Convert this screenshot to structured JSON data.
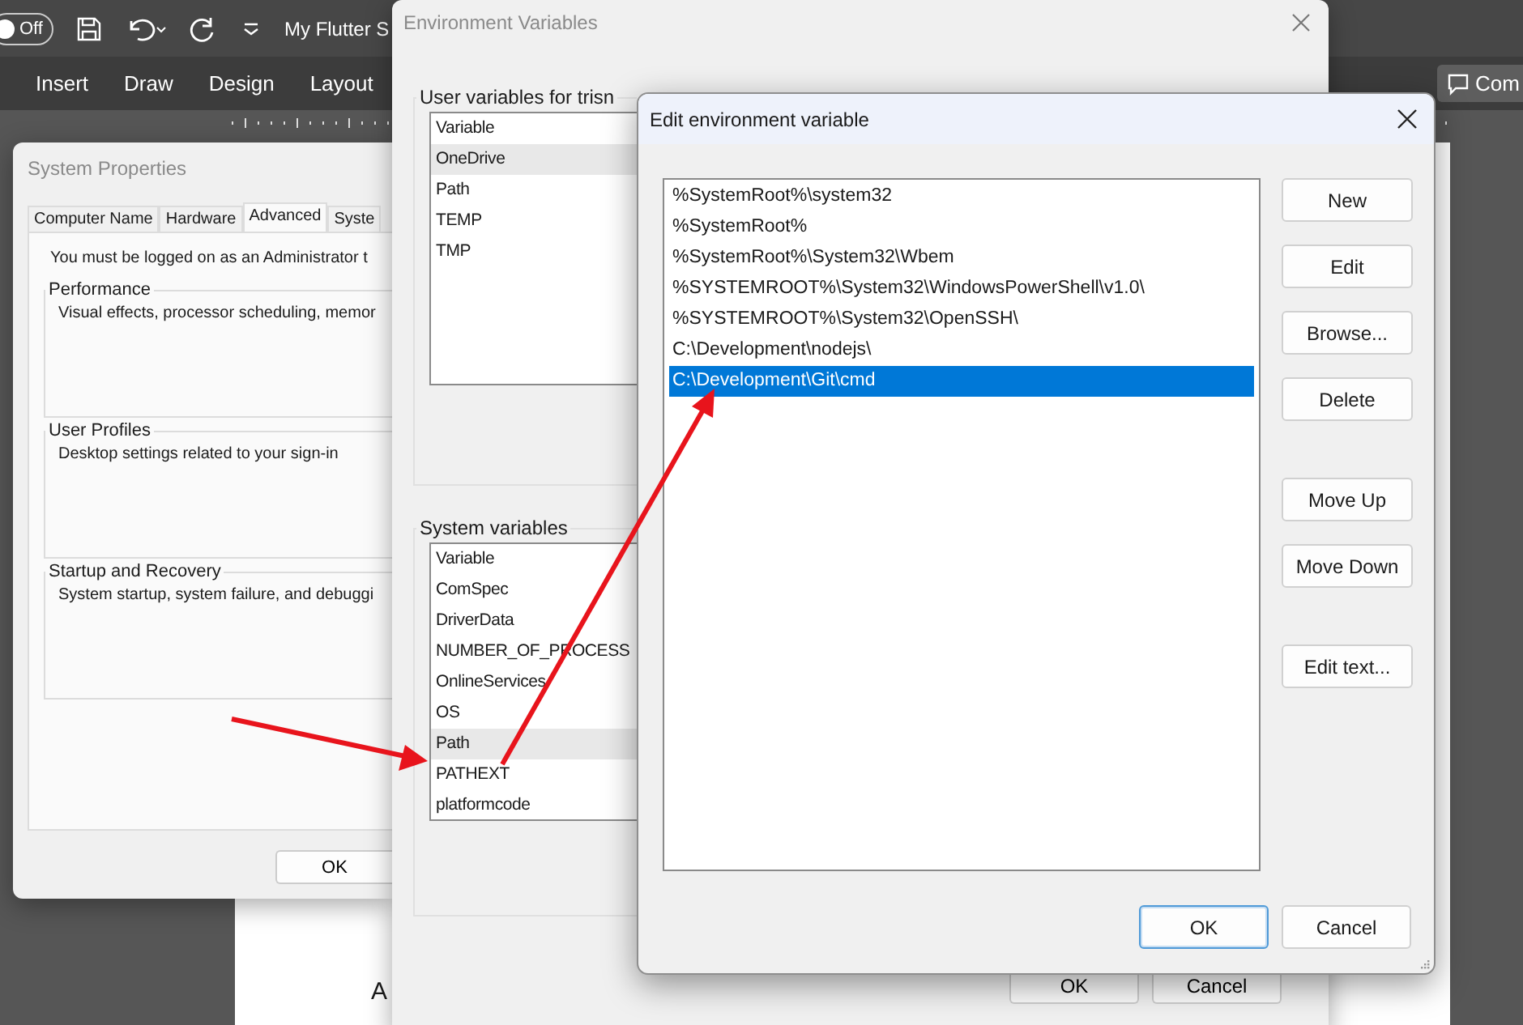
{
  "word": {
    "autosave": {
      "label": "Off",
      "on": false
    },
    "title": "My Flutter S",
    "ribbon_tabs": [
      "Insert",
      "Draw",
      "Design",
      "Layout"
    ],
    "comments_button": "Com",
    "page_text": "A"
  },
  "system_properties": {
    "title": "System Properties",
    "tabs": [
      {
        "label": "Computer Name",
        "selected": false
      },
      {
        "label": "Hardware",
        "selected": false
      },
      {
        "label": "Advanced",
        "selected": true
      },
      {
        "label": "Syste",
        "selected": false
      }
    ],
    "notice": "You must be logged on as an Administrator t",
    "groups": [
      {
        "title": "Performance",
        "description": "Visual effects, processor scheduling, memor"
      },
      {
        "title": "User Profiles",
        "description": "Desktop settings related to your sign-in"
      },
      {
        "title": "Startup and Recovery",
        "description": "System startup, system failure, and debuggi"
      }
    ],
    "ok_button": "OK"
  },
  "environment_variables": {
    "title": "Environment Variables",
    "user_variables": {
      "label": "User variables for trisn",
      "header": "Variable",
      "rows": [
        {
          "name": "OneDrive",
          "selected": true
        },
        {
          "name": "Path",
          "selected": false
        },
        {
          "name": "TEMP",
          "selected": false
        },
        {
          "name": "TMP",
          "selected": false
        }
      ]
    },
    "system_variables": {
      "label": "System variables",
      "header": "Variable",
      "rows": [
        {
          "name": "ComSpec",
          "selected": false
        },
        {
          "name": "DriverData",
          "selected": false
        },
        {
          "name": "NUMBER_OF_PROCESS",
          "selected": false
        },
        {
          "name": "OnlineServices",
          "selected": false
        },
        {
          "name": "OS",
          "selected": false
        },
        {
          "name": "Path",
          "selected": true
        },
        {
          "name": "PATHEXT",
          "selected": false
        },
        {
          "name": "platformcode",
          "selected": false
        }
      ]
    },
    "buttons": [
      "OK",
      "Cancel"
    ]
  },
  "edit_dialog": {
    "title": "Edit environment variable",
    "entries": [
      {
        "text": "%SystemRoot%\\system32",
        "selected": false
      },
      {
        "text": "%SystemRoot%",
        "selected": false
      },
      {
        "text": "%SystemRoot%\\System32\\Wbem",
        "selected": false
      },
      {
        "text": "%SYSTEMROOT%\\System32\\WindowsPowerShell\\v1.0\\",
        "selected": false
      },
      {
        "text": "%SYSTEMROOT%\\System32\\OpenSSH\\",
        "selected": false
      },
      {
        "text": "C:\\Development\\nodejs\\",
        "selected": false
      },
      {
        "text": "C:\\Development\\Git\\cmd",
        "selected": true
      }
    ],
    "button_groups": [
      {
        "buttons": [
          "New",
          "Edit",
          "Browse...",
          "Delete"
        ]
      },
      {
        "buttons": [
          "Move Up",
          "Move Down"
        ]
      },
      {
        "buttons": [
          "Edit text..."
        ]
      }
    ],
    "buttons": [
      {
        "label": "OK",
        "focused": true
      },
      {
        "label": "Cancel",
        "focused": false
      }
    ]
  }
}
